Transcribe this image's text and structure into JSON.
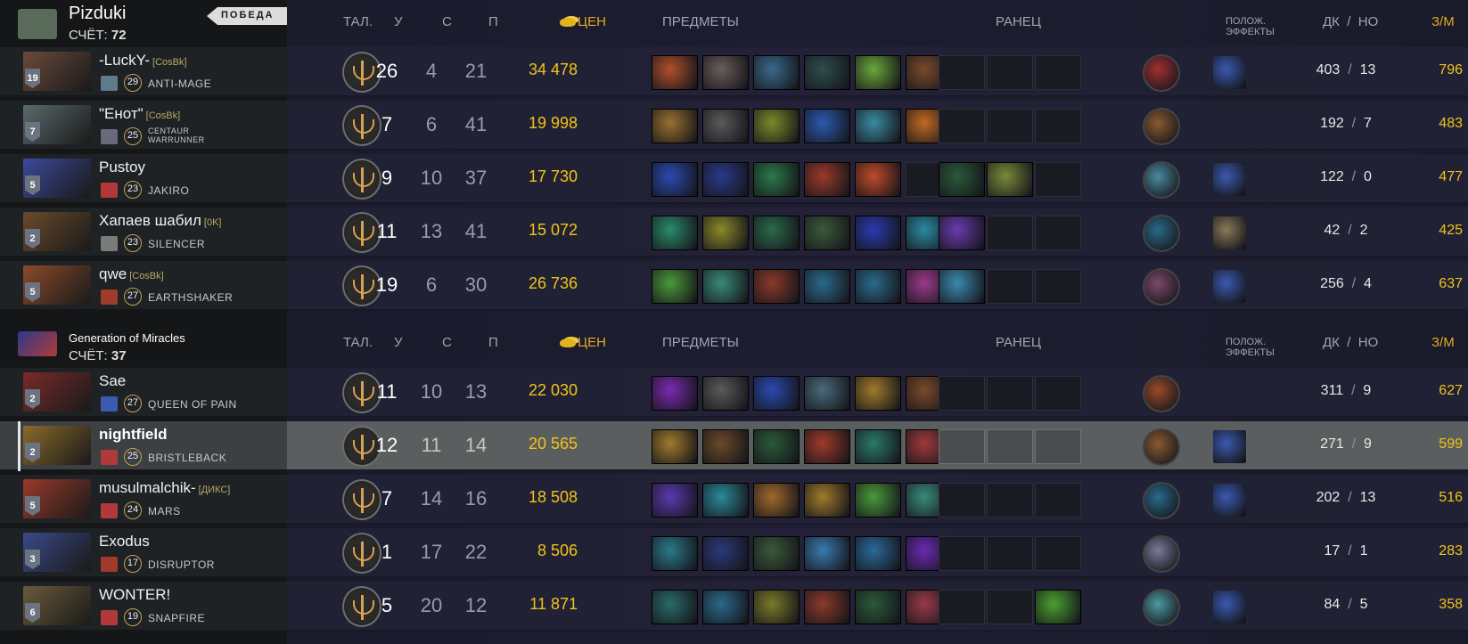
{
  "top_team": {
    "name": "Pizduki",
    "score_label": "СЧЁТ:",
    "score": "72",
    "win_badge": "ПОБЕДА"
  },
  "bottom_team": {
    "name": "Generation of Miracles",
    "score_label": "СЧЁТ:",
    "score": "37"
  },
  "headers": {
    "talents": "ТАЛ.",
    "kills": "У",
    "deaths": "С",
    "assists": "П",
    "networth": "ЦЕН",
    "items": "ПРЕДМЕТЫ",
    "backpack": "РАНЕЦ",
    "effects_line1": "ПОЛОЖ.",
    "effects_line2": "ЭФФЕКТЫ",
    "lh": "ДК",
    "sep": "/",
    "dn": "НО",
    "gpm": "З/М"
  },
  "players": [
    {
      "name": "-LuckY-",
      "tag": "[CosBk]",
      "level": "29",
      "hero": "ANTI-MAGE",
      "portrait_level": "19",
      "kills": "26",
      "deaths": "4",
      "assists": "21",
      "networth": "34 478",
      "lh": "403",
      "dn": "13",
      "gpm": "796",
      "portrait_color": "#6b4a3a",
      "icon_color": "#5f7a8a",
      "items": [
        "#b0502a",
        "#6a5d58",
        "#3a6a8a",
        "#2e4e4e",
        "#6aa83a",
        "#7a4a2a"
      ],
      "backpack": [
        "empty",
        "empty",
        "empty"
      ],
      "neutral": "#a03030",
      "buff": "#3a5ab0"
    },
    {
      "name": "\"Енот\"",
      "tag": "[CosBk]",
      "level": "25",
      "hero": "CENTAUR WARRUNNER",
      "portrait_level": "7",
      "kills": "7",
      "deaths": "6",
      "assists": "41",
      "networth": "19 998",
      "lh": "192",
      "dn": "7",
      "gpm": "483",
      "portrait_color": "#5a6a6a",
      "icon_color": "#6a6a7a",
      "items": [
        "#9a7030",
        "#5a5a5a",
        "#7a8a2a",
        "#2a5ab0",
        "#3a8aa0",
        "#c06a20"
      ],
      "backpack": [
        "empty",
        "empty",
        "empty"
      ],
      "neutral": "#8a5a30",
      "buff": ""
    },
    {
      "name": "Pustoy",
      "tag": "",
      "level": "23",
      "hero": "JAKIRO",
      "portrait_level": "5",
      "kills": "9",
      "deaths": "10",
      "assists": "37",
      "networth": "17 730",
      "lh": "122",
      "dn": "0",
      "gpm": "477",
      "portrait_color": "#3a4a9a",
      "icon_color": "#b03a3a",
      "items": [
        "#2a4ab0",
        "#2a3a8a",
        "#2a7a4a",
        "#9a3a2a",
        "#c04a2a",
        "empty"
      ],
      "backpack": [
        "#2a5a3a",
        "#7a8a3a",
        "empty"
      ],
      "neutral": "#4a8aa0",
      "buff": "#3a5ab0"
    },
    {
      "name": "Хапаев шабил",
      "tag": "[0K]",
      "level": "23",
      "hero": "SILENCER",
      "portrait_level": "2",
      "kills": "11",
      "deaths": "13",
      "assists": "41",
      "networth": "15 072",
      "lh": "42",
      "dn": "2",
      "gpm": "425",
      "portrait_color": "#6a4a2a",
      "icon_color": "#7a7a7a",
      "items": [
        "#2a8a6a",
        "#8a8a2a",
        "#2a6a4a",
        "#3a5a3a",
        "#2a3ab0",
        "#2a8aa0"
      ],
      "backpack": [
        "#6a3ab0",
        "empty",
        "empty"
      ],
      "neutral": "#2a6a8a",
      "buff": "#8a7a5a"
    },
    {
      "name": "qwe",
      "tag": "[CosBk]",
      "level": "27",
      "hero": "EARTHSHAKER",
      "portrait_level": "5",
      "kills": "19",
      "deaths": "6",
      "assists": "30",
      "networth": "26 736",
      "lh": "256",
      "dn": "4",
      "gpm": "637",
      "portrait_color": "#8a4a2a",
      "icon_color": "#a03a2a",
      "items": [
        "#4a9a3a",
        "#3a8a7a",
        "#8a3a2a",
        "#2a6a8a",
        "#2a6a8a",
        "#9a3a8a"
      ],
      "backpack": [
        "#3a8ab0",
        "empty",
        "empty"
      ],
      "neutral": "#7a4a6a",
      "buff": "#3a5ab0"
    },
    {
      "name": "Sae",
      "tag": "",
      "level": "27",
      "hero": "QUEEN OF PAIN",
      "portrait_level": "2",
      "kills": "11",
      "deaths": "10",
      "assists": "13",
      "networth": "22 030",
      "lh": "311",
      "dn": "9",
      "gpm": "627",
      "portrait_color": "#7a2a2a",
      "icon_color": "#3a5ab0",
      "items": [
        "#7a2ab0",
        "#5a5a5a",
        "#2a4ab0",
        "#4a6a7a",
        "#a07a2a",
        "#7a4a2a"
      ],
      "backpack": [
        "empty",
        "empty",
        "empty"
      ],
      "neutral": "#9a4a2a",
      "buff": ""
    },
    {
      "name": "nightfield",
      "tag": "",
      "level": "25",
      "hero": "BRISTLEBACK",
      "portrait_level": "2",
      "kills": "12",
      "deaths": "11",
      "assists": "14",
      "networth": "20 565",
      "lh": "271",
      "dn": "9",
      "gpm": "599",
      "portrait_color": "#8a6a2a",
      "icon_color": "#b03a3a",
      "items": [
        "#a07a2a",
        "#6a4a2a",
        "#2a5a3a",
        "#a03a2a",
        "#2a7a6a",
        "#a03a3a"
      ],
      "backpack": [
        "empty",
        "empty",
        "empty"
      ],
      "neutral": "#8a5a30",
      "buff": "#3a5ab0",
      "selected": true
    },
    {
      "name": "musulmalchik-",
      "tag": "[ДИКС]",
      "level": "24",
      "hero": "MARS",
      "portrait_level": "5",
      "kills": "7",
      "deaths": "14",
      "assists": "16",
      "networth": "18 508",
      "lh": "202",
      "dn": "13",
      "gpm": "516",
      "portrait_color": "#9a3a2a",
      "icon_color": "#b03a3a",
      "items": [
        "#5a3ab0",
        "#2a8a9a",
        "#a06a2a",
        "#a07a2a",
        "#4a9a3a",
        "#3a8a7a"
      ],
      "backpack": [
        "empty",
        "empty",
        "empty"
      ],
      "neutral": "#2a6a8a",
      "buff": "#3a5ab0"
    },
    {
      "name": "Exodus",
      "tag": "",
      "level": "17",
      "hero": "DISRUPTOR",
      "portrait_level": "3",
      "kills": "1",
      "deaths": "17",
      "assists": "22",
      "networth": "8 506",
      "lh": "17",
      "dn": "1",
      "gpm": "283",
      "portrait_color": "#3a4a8a",
      "icon_color": "#a03a2a",
      "items": [
        "#2a7a8a",
        "#2a3a7a",
        "#3a5a3a",
        "#3a7ab0",
        "#2a6a9a",
        "#6a2ab0"
      ],
      "backpack": [
        "empty",
        "empty",
        "empty"
      ],
      "neutral": "#7a7a9a",
      "buff": ""
    },
    {
      "name": "WONTER!",
      "tag": "",
      "level": "19",
      "hero": "SNAPFIRE",
      "portrait_level": "6",
      "kills": "5",
      "deaths": "20",
      "assists": "12",
      "networth": "11 871",
      "lh": "84",
      "dn": "5",
      "gpm": "358",
      "portrait_color": "#6a5a3a",
      "icon_color": "#b03a3a",
      "items": [
        "#2a6a6a",
        "#2a6a8a",
        "#7a7a2a",
        "#8a3a2a",
        "#2a5a3a",
        "#9a3a4a"
      ],
      "backpack": [
        "empty",
        "empty",
        "#4aa030"
      ],
      "neutral": "#4a9aa0",
      "buff": "#3a5ab0"
    }
  ]
}
